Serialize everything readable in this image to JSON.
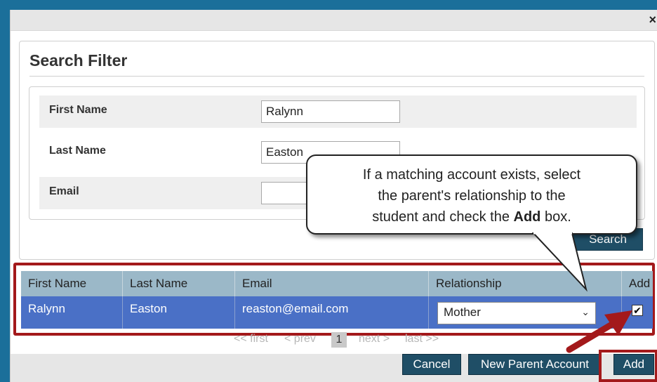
{
  "dialog": {
    "close_glyph": "×"
  },
  "search_filter": {
    "title": "Search Filter",
    "fields": [
      {
        "label": "First Name",
        "value": "Ralynn"
      },
      {
        "label": "Last Name",
        "value": "Easton"
      },
      {
        "label": "Email",
        "value": ""
      }
    ],
    "search_button": "Search"
  },
  "callout": {
    "line1": "If a matching account exists, select",
    "line2": "the parent's relationship to the",
    "line3_pre": "student and check the ",
    "line3_bold": "Add",
    "line3_post": " box."
  },
  "results": {
    "headers": [
      "First Name",
      "Last Name",
      "Email",
      "Relationship",
      "Add"
    ],
    "rows": [
      {
        "first_name": "Ralynn",
        "last_name": "Easton",
        "email": "reaston@email.com",
        "relationship": "Mother",
        "add_checked": "✔"
      }
    ]
  },
  "pager": {
    "first": "<< first",
    "prev": "< prev",
    "current": "1",
    "next": "next >",
    "last": "last >>"
  },
  "footer": {
    "cancel": "Cancel",
    "new_parent": "New Parent Account",
    "add": "Add"
  },
  "colors": {
    "highlight_red": "#a3191b",
    "button_navy": "#1f4e66",
    "row_blue": "#4a70c6",
    "header_steel": "#9bb8c8"
  }
}
